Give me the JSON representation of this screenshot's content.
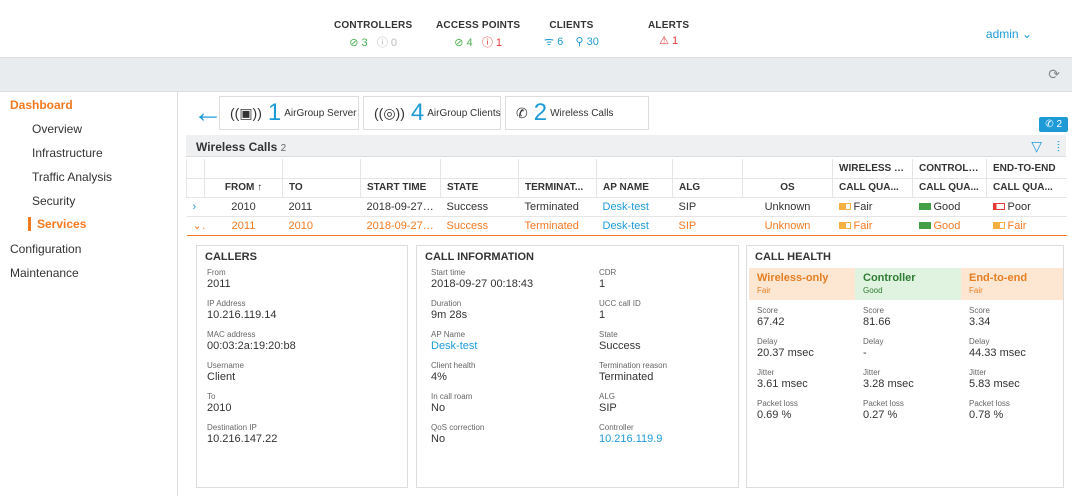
{
  "header": {
    "controllers": {
      "label": "CONTROLLERS",
      "up": "3",
      "down": "0"
    },
    "access_points": {
      "label": "ACCESS POINTS",
      "up": "4",
      "down": "1"
    },
    "clients": {
      "label": "CLIENTS",
      "wireless": "6",
      "wired": "30"
    },
    "alerts": {
      "label": "ALERTS",
      "count": "1"
    },
    "user": "admin"
  },
  "sidebar": {
    "items": [
      {
        "label": "Dashboard"
      },
      {
        "label": "Overview"
      },
      {
        "label": "Infrastructure"
      },
      {
        "label": "Traffic Analysis"
      },
      {
        "label": "Security"
      },
      {
        "label": "Services"
      },
      {
        "label": "Configuration"
      },
      {
        "label": "Maintenance"
      }
    ]
  },
  "tiles": [
    {
      "num": "1",
      "cap": "AirGroup Server",
      "icon": "airgroup-server-icon"
    },
    {
      "num": "4",
      "cap": "AirGroup Clients",
      "icon": "airgroup-clients-icon"
    },
    {
      "num": "2",
      "cap": "Wireless Calls",
      "icon": "phone-icon"
    }
  ],
  "badge": "2",
  "wireless_calls": {
    "title": "Wireless Calls",
    "count": "2"
  },
  "table": {
    "group_headers": [
      "WIRELESS O...",
      "CONTROLLER",
      "END-TO-END"
    ],
    "columns": [
      "FROM",
      "TO",
      "START TIME",
      "STATE",
      "TERMINAT...",
      "AP NAME",
      "ALG",
      "OS",
      "CALL QUA...",
      "CALL QUA...",
      "CALL QUA..."
    ],
    "rows": [
      {
        "from": "2010",
        "to": "2011",
        "start": "2018-09-27 00...",
        "state": "Success",
        "term": "Terminated",
        "ap": "Desk-test",
        "alg": "SIP",
        "os": "Unknown",
        "q1": "Fair",
        "q2": "Good",
        "q3": "Poor"
      },
      {
        "from": "2011",
        "to": "2010",
        "start": "2018-09-27 00...",
        "state": "Success",
        "term": "Terminated",
        "ap": "Desk-test",
        "alg": "SIP",
        "os": "Unknown",
        "q1": "Fair",
        "q2": "Good",
        "q3": "Fair"
      }
    ]
  },
  "callers": {
    "title": "CALLERS",
    "fields": [
      {
        "k": "From",
        "v": "2011"
      },
      {
        "k": "IP Address",
        "v": "10.216.119.14"
      },
      {
        "k": "MAC address",
        "v": "00:03:2a:19:20:b8"
      },
      {
        "k": "Username",
        "v": "Client"
      },
      {
        "k": "To",
        "v": "2010"
      },
      {
        "k": "Destination IP",
        "v": "10.216.147.22"
      }
    ]
  },
  "call_info": {
    "title": "CALL INFORMATION",
    "left": [
      {
        "k": "Start time",
        "v": "2018-09-27 00:18:43"
      },
      {
        "k": "Duration",
        "v": "9m 28s"
      },
      {
        "k": "AP Name",
        "v": "Desk-test"
      },
      {
        "k": "Client health",
        "v": "4%"
      },
      {
        "k": "In call roam",
        "v": "No"
      },
      {
        "k": "QoS correction",
        "v": "No"
      }
    ],
    "right": [
      {
        "k": "CDR",
        "v": "1"
      },
      {
        "k": "UCC call ID",
        "v": "1"
      },
      {
        "k": "State",
        "v": "Success"
      },
      {
        "k": "Termination reason",
        "v": "Terminated"
      },
      {
        "k": "ALG",
        "v": "SIP"
      },
      {
        "k": "Controller",
        "v": "10.216.119.9"
      }
    ]
  },
  "call_health": {
    "title": "CALL HEALTH",
    "cols": [
      {
        "name": "Wireless-only",
        "status": "Fair",
        "score": "67.42",
        "delay": "20.37 msec",
        "jitter": "3.61 msec",
        "loss": "0.69 %"
      },
      {
        "name": "Controller",
        "status": "Good",
        "score": "81.66",
        "delay": "-",
        "jitter": "3.28 msec",
        "loss": "0.27 %"
      },
      {
        "name": "End-to-end",
        "status": "Fair",
        "score": "3.34",
        "delay": "44.33 msec",
        "jitter": "5.83 msec",
        "loss": "0.78 %"
      }
    ],
    "labels": {
      "score": "Score",
      "delay": "Delay",
      "jitter": "Jitter",
      "loss": "Packet loss"
    }
  },
  "colors": {
    "accent": "#1e9bd7",
    "orange": "#f47920",
    "ok": "#4caf50",
    "err": "#e53935"
  }
}
